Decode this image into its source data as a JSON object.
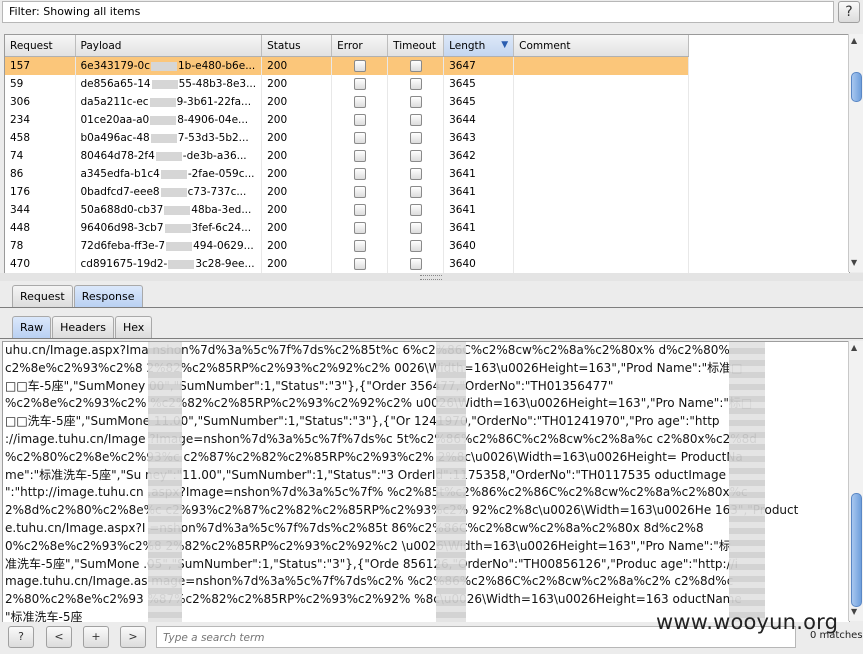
{
  "filter": {
    "text": "Filter: Showing all items",
    "help_label": "?"
  },
  "table": {
    "columns": [
      "Request",
      "Payload",
      "Status",
      "Error",
      "Timeout",
      "Length",
      "Comment"
    ],
    "sorted_column": "Length",
    "rows": [
      {
        "request": "157",
        "payload_a": "6e343179-0c",
        "payload_b": "1b-e480-b6e...",
        "status": "200",
        "length": "3647",
        "selected": true
      },
      {
        "request": "59",
        "payload_a": "de856a65-14",
        "payload_b": "55-48b3-8e3...",
        "status": "200",
        "length": "3645",
        "selected": false
      },
      {
        "request": "306",
        "payload_a": "da5a211c-ec",
        "payload_b": "9-3b61-22fa...",
        "status": "200",
        "length": "3645",
        "selected": false
      },
      {
        "request": "234",
        "payload_a": "01ce20aa-a0",
        "payload_b": "8-4906-04e...",
        "status": "200",
        "length": "3644",
        "selected": false
      },
      {
        "request": "458",
        "payload_a": "b0a496ac-48",
        "payload_b": "7-53d3-5b2...",
        "status": "200",
        "length": "3643",
        "selected": false
      },
      {
        "request": "74",
        "payload_a": "80464d78-2f4",
        "payload_b": "-de3b-a36...",
        "status": "200",
        "length": "3642",
        "selected": false
      },
      {
        "request": "86",
        "payload_a": "a345edfa-b1c4",
        "payload_b": "-2fae-059c...",
        "status": "200",
        "length": "3641",
        "selected": false
      },
      {
        "request": "176",
        "payload_a": "0badfcd7-eee8",
        "payload_b": "c73-737c...",
        "status": "200",
        "length": "3641",
        "selected": false
      },
      {
        "request": "344",
        "payload_a": "50a688d0-cb37",
        "payload_b": "48ba-3ed...",
        "status": "200",
        "length": "3641",
        "selected": false
      },
      {
        "request": "448",
        "payload_a": "96406d98-3cb7",
        "payload_b": "3fef-6c24...",
        "status": "200",
        "length": "3641",
        "selected": false
      },
      {
        "request": "78",
        "payload_a": "72d6feba-ff3e-7",
        "payload_b": "494-0629...",
        "status": "200",
        "length": "3640",
        "selected": false
      },
      {
        "request": "470",
        "payload_a": "cd891675-19d2-",
        "payload_b": "3c28-9ee...",
        "status": "200",
        "length": "3640",
        "selected": false
      }
    ]
  },
  "tabs_top": [
    "Request",
    "Response"
  ],
  "tabs_top_active": "Response",
  "tabs_view": [
    "Raw",
    "Headers",
    "Hex"
  ],
  "tabs_view_active": "Raw",
  "raw_lines": [
    "uhu.cn/Image.aspx?Ima    nshon%7d%3a%5c%7f%7ds%c2%85t%c    6%c2%86C%c2%8cw%c2%8a%c2%80x%    d%c2%80%",
    "c2%8e%c2%93%c2%8    2%82%c2%85RP%c2%93%c2%92%c2%    0026\\Width=163\\u0026Height=163\",\"Prod    Name\":\"标准□",
    "□□车-5座\",\"SumMoney  00\",\"SumNumber\":1,\"Status\":\"3\"},{\"Order    356477,\"OrderNo\":\"TH01356477\"",
    "%c2%8e%c2%93%c2%    %c2%82%c2%85RP%c2%93%c2%92%c2%    u0026\\Width=163\\u0026Height=163\",\"Pro    Name\":\"标□",
    "□□洗车-5座\",\"SumMone  11.00\",\"SumNumber\":1,\"Status\":\"3\"},{\"Or    1241970,\"OrderNo\":\"TH01241970\",\"Pro    age\":\"http",
    "://image.tuhu.cn/Image    ?Image=nshon%7d%3a%5c%7f%7ds%c    5t%c2%86%c2%86C%c2%8cw%c2%8a%c    c2%80x%c2%8d",
    "%c2%80%c2%8e%c2%93%c    c2%87%c2%82%c2%85RP%c2%93%c2%    2%8c\\u0026\\Width=163\\u0026Height=    ProductNa",
    "me\":\"标准洗车-5座\",\"Su    ney\":\"11.00\",\"SumNumber\":1,\"Status\":\"3    OrderId\":1175358,\"OrderNo\":\"TH0117535    oductImage",
    "\":\"http://image.tuhu.cn    .aspx?Image=nshon%7d%3a%5c%7f%    %c2%85t%c2%86%c2%86C%c2%8cw%c2%8a%c2%80x%c",
    "2%8d%c2%80%c2%8e%c    c2%93%c2%87%c2%82%c2%85RP%c2%93%c2%    92%c2%8c\\u0026\\Width=163\\u0026He    163\",\"Product",
    "e.tuhu.cn/Image.aspx?I    =nshon%7d%3a%5c%7f%7ds%c2%85t    86%c2%86C%c2%8cw%c2%8a%c2%80x    8d%c2%8",
    "0%c2%8e%c2%93%c2%8    2%82%c2%85RP%c2%93%c2%92%c2    \\u0026\\Width=163\\u0026Height=163\",\"Pro    Name\":\"标",
    "准洗车-5座\",\"SumMone  .05\",\"SumNumber\":1,\"Status\":\"3\"},{\"Orde    856126,\"OrderNo\":\"TH00856126\",\"Produc    age\":\"http://i",
    "mage.tuhu.cn/Image.as    mage=nshon%7d%3a%5c%7f%7ds%c2%    %c2%86%c2%86C%c2%8cw%c2%8a%c2%    c2%8d%c",
    "2%80%c2%8e%c2%93    %87%c2%82%c2%85RP%c2%93%c2%92%    %8c\\u0026\\Width=163\\u0026Height=163    oductName",
    "\"标准洗车-5座"
  ],
  "search": {
    "help_label": "?",
    "prev_label": "<",
    "add_label": "+",
    "next_label": ">",
    "placeholder": "Type a search term",
    "matches": "0 matches"
  },
  "watermark": "www.wooyun.org"
}
